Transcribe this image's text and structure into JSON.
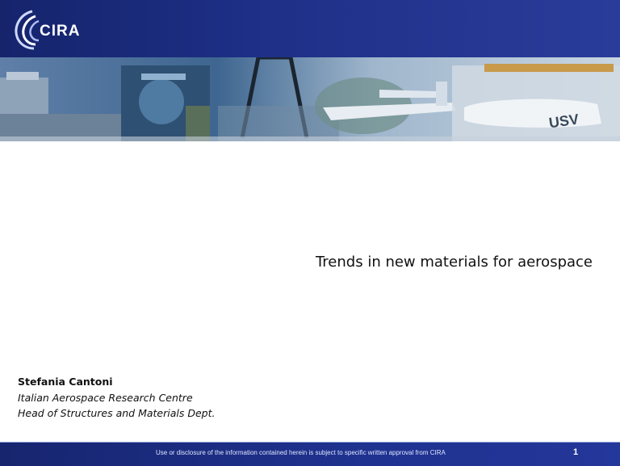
{
  "header": {
    "logo_text": "CIRA"
  },
  "slide": {
    "title": "Trends in new materials for aerospace",
    "author_name": "Stefania Cantoni",
    "author_org": "Italian Aerospace Research Centre",
    "author_role": "Head of Structures and Materials Dept."
  },
  "footer": {
    "disclaimer": "Use or disclosure of the information contained herein is subject to specific written approval from CIRA",
    "page_number": "1"
  }
}
